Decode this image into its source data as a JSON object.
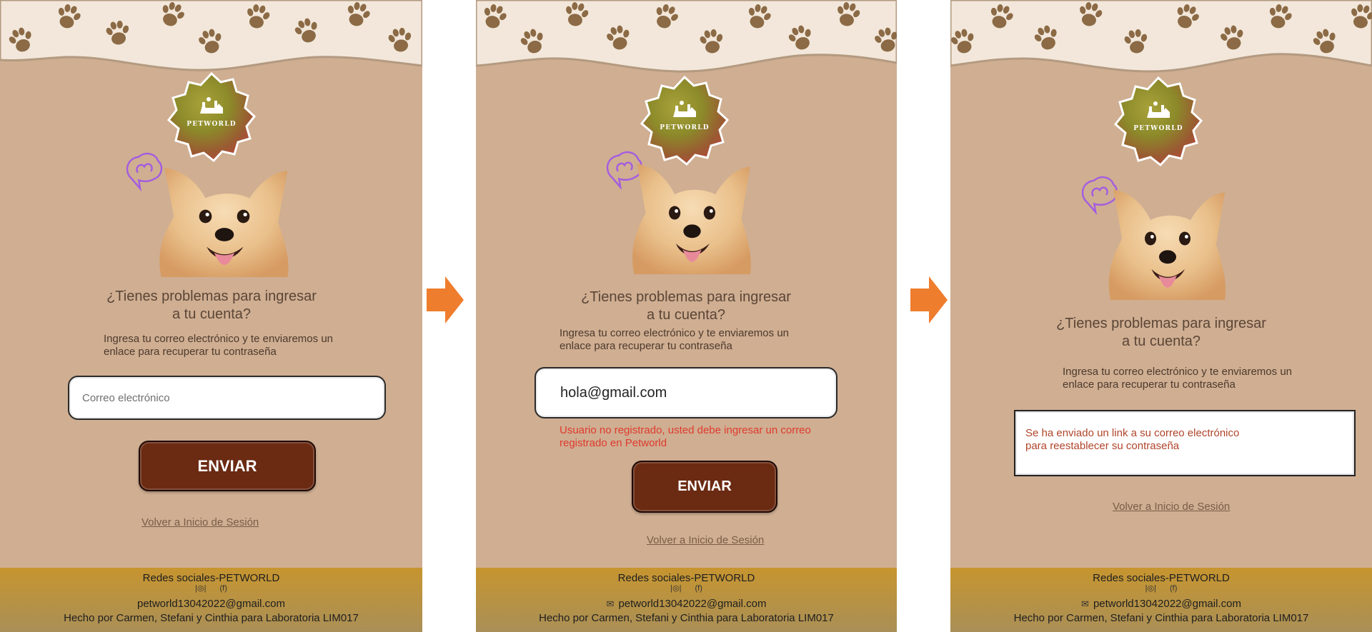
{
  "colors": {
    "panel_bg": "#cfae92",
    "wave_bg": "#f2e7da",
    "paw": "#8b6a45",
    "button": "#6b2a12",
    "error": "#e03a2d",
    "confirm_text": "#b0442a",
    "arrow": "#ef7d2e",
    "footer": "#c7952f"
  },
  "brand": {
    "badge_text": "PETWORLD"
  },
  "screens": [
    {
      "title_line1": "¿Tienes problemas para ingresar",
      "title_line2": "a tu cuenta?",
      "subtitle_line1": "Ingresa tu correo electrónico y te enviaremos un",
      "subtitle_line2": "enlace para recuperar tu contraseña",
      "email_placeholder": "Correo electrónico",
      "send_label": "ENVIAR",
      "back_link": "Volver a Inicio de Sesión"
    },
    {
      "title_line1": "¿Tienes problemas para ingresar",
      "title_line2": "a tu cuenta?",
      "subtitle_line1": "Ingresa tu correo electrónico y te enviaremos un",
      "subtitle_line2": "enlace para recuperar tu contraseña",
      "email_value": "hola@gmail.com",
      "error_line1": "Usuario no registrado, usted debe ingresar un correo",
      "error_line2": "registrado en Petworld",
      "send_label": "ENVIAR",
      "back_link": "Volver a Inicio de Sesión"
    },
    {
      "title_line1": "¿Tienes problemas para ingresar",
      "title_line2": "a tu cuenta?",
      "subtitle_line1": "Ingresa tu correo electrónico y te enviaremos un",
      "subtitle_line2": "enlace para recuperar tu contraseña",
      "confirm_line1": "Se ha enviado un link a su correo electrónico",
      "confirm_line2": "para reestablecer su contraseña",
      "back_link": "Volver a Inicio de Sesión"
    }
  ],
  "footer": {
    "title": "Redes sociales-PETWORLD",
    "instagram_glyph": "|◎|",
    "facebook_glyph": "(f)",
    "mail_glyph": "✉",
    "email": "petworld13042022@gmail.com",
    "credit": "Hecho por Carmen, Stefani y Cinthia para Laboratoria LIM017"
  },
  "icons": [
    "paw-print-icon",
    "petworld-logo",
    "dog-photo",
    "thought-bubble-icon",
    "instagram-icon",
    "facebook-icon",
    "mail-icon",
    "arrow-right-icon"
  ]
}
